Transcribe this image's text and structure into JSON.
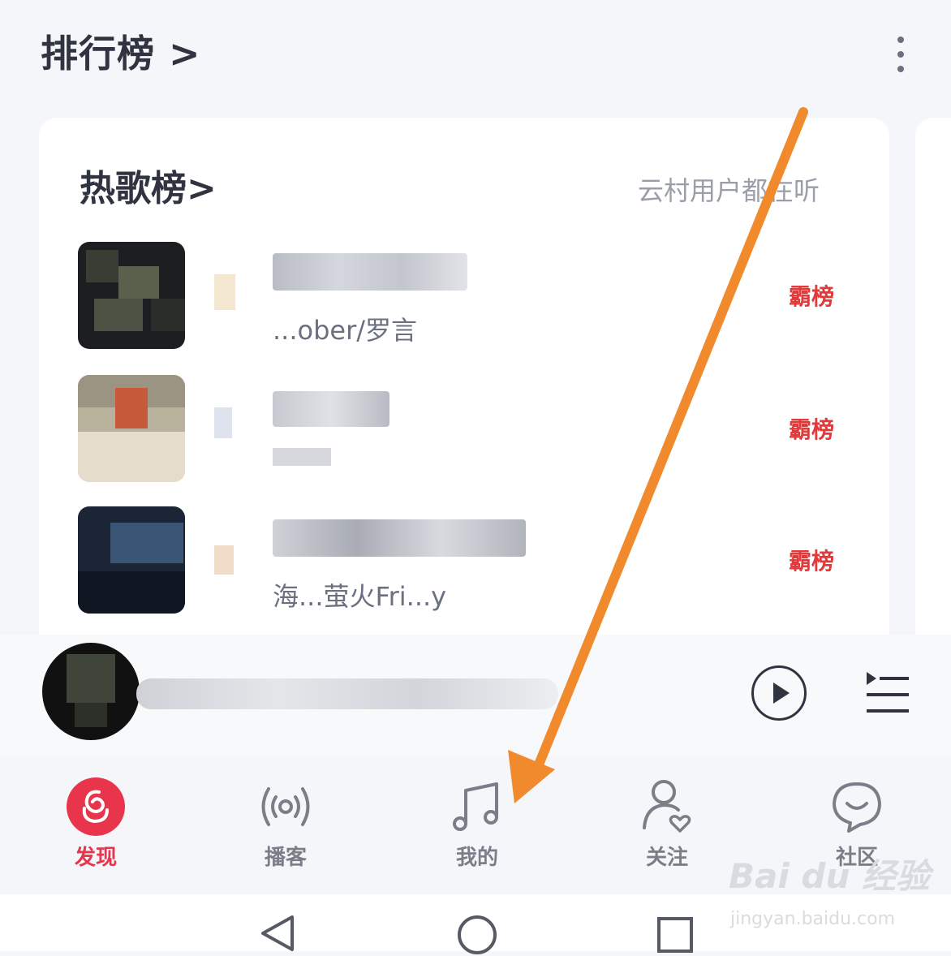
{
  "header": {
    "title": "排行榜 >"
  },
  "card": {
    "title": "热歌榜>",
    "subtitle": "云村用户都在听",
    "songs": [
      {
        "artist": "...ober/罗言",
        "badge": "霸榜"
      },
      {
        "artist": "",
        "badge": "霸榜"
      },
      {
        "artist": "海...萤火Fri...y",
        "badge": "霸榜"
      }
    ]
  },
  "tabs": [
    {
      "label": "发现",
      "icon": "netease-music-logo-icon",
      "active": true
    },
    {
      "label": "播客",
      "icon": "podcast-icon",
      "active": false
    },
    {
      "label": "我的",
      "icon": "music-note-icon",
      "active": false
    },
    {
      "label": "关注",
      "icon": "follow-person-icon",
      "active": false
    },
    {
      "label": "社区",
      "icon": "community-chat-icon",
      "active": false
    }
  ],
  "watermark": {
    "brand": "Bai du 经验",
    "url": "jingyan.baidu.com"
  },
  "colors": {
    "accent": "#e8354b",
    "badge": "#e23a3a",
    "arrow": "#f08a2c"
  }
}
